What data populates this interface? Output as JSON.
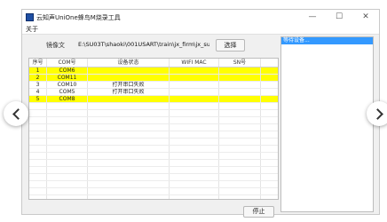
{
  "window": {
    "title": "云知声UniOne蜂鸟M烧录工具",
    "controls": {
      "minimize": "—",
      "maximize": "☐",
      "close": "✕"
    }
  },
  "menu": {
    "items": [
      "关于"
    ]
  },
  "firmware": {
    "label": "镜像文",
    "path": "E:\\SU03T\\shaoki\\001USART\\train\\jx_firm\\jx_su_03t_",
    "select_button": "选择"
  },
  "table": {
    "columns": [
      "序号",
      "COM号",
      "设备状态",
      "WIFI MAC",
      "SN号"
    ],
    "rows": [
      {
        "cells": [
          "1",
          "COM6",
          "",
          "",
          ""
        ],
        "highlight": true
      },
      {
        "cells": [
          "2",
          "COM11",
          "",
          "",
          ""
        ],
        "highlight": true
      },
      {
        "cells": [
          "3",
          "COM10",
          "打开串口失败",
          "",
          ""
        ],
        "highlight": false
      },
      {
        "cells": [
          "4",
          "COM5",
          "打开串口失败",
          "",
          ""
        ],
        "highlight": false
      },
      {
        "cells": [
          "5",
          "COM8",
          "",
          "",
          ""
        ],
        "highlight": true
      }
    ],
    "highlight_color": "#ffff00"
  },
  "log": {
    "lines": [
      "等待设备..."
    ]
  },
  "stop_button": "停止",
  "gallery": {
    "prev_icon": "chevron-left-icon",
    "next_icon": "chevron-right-icon"
  }
}
